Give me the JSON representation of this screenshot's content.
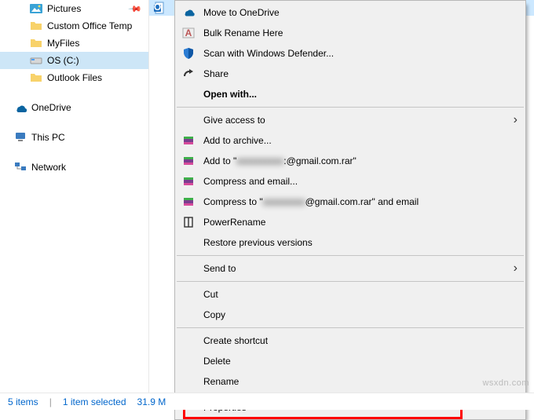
{
  "nav": {
    "pictures": "Pictures",
    "custom_office": "Custom Office Temp",
    "myfiles": "MyFiles",
    "os_c": "OS (C:)",
    "outlook": "Outlook Files",
    "onedrive": "OneDrive",
    "thispc": "This PC",
    "network": "Network"
  },
  "menu": {
    "move_onedrive": "Move to OneDrive",
    "bulk_rename": "Bulk Rename Here",
    "defender": "Scan with Windows Defender...",
    "share": "Share",
    "open_with": "Open with...",
    "give_access": "Give access to",
    "add_archive": "Add to archive...",
    "add_to_prefix": "Add to \"",
    "add_to_mid": ":@gmail.com.rar\"",
    "compress_email": "Compress and email...",
    "compress_to_prefix": "Compress to \"",
    "compress_to_mid": "@gmail.com.rar\" and email",
    "powerrename": "PowerRename",
    "restore": "Restore previous versions",
    "send_to": "Send to",
    "cut": "Cut",
    "copy": "Copy",
    "create_shortcut": "Create shortcut",
    "delete": "Delete",
    "rename": "Rename",
    "properties": "Properties",
    "blur1": "xxxxxxxxxx",
    "blur2": "xxxxxxxxx"
  },
  "status": {
    "items": "5 items",
    "selected": "1 item selected",
    "size": "31.9 M"
  },
  "watermark": "wsxdn.com"
}
